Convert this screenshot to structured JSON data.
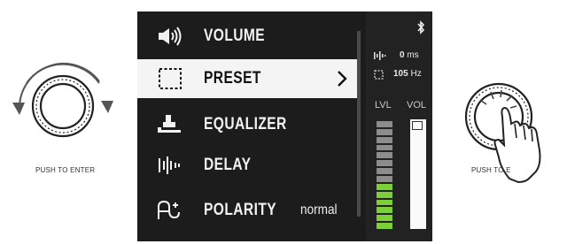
{
  "left_knob": {
    "caption": "PUSH TO ENTER"
  },
  "right_knob": {
    "caption": "PUSH TO E"
  },
  "menu": {
    "items": [
      {
        "label": "VOLUME",
        "icon": "speaker-icon",
        "selected": false,
        "value": ""
      },
      {
        "label": "PRESET",
        "icon": "dashed-square-icon",
        "selected": true,
        "value": "",
        "chevron": ">"
      },
      {
        "label": "EQUALIZER",
        "icon": "equalizer-icon",
        "selected": false,
        "value": ""
      },
      {
        "label": "DELAY",
        "icon": "delay-icon",
        "selected": false,
        "value": ""
      },
      {
        "label": "POLARITY",
        "icon": "polarity-icon",
        "selected": false,
        "value": "normal"
      }
    ]
  },
  "status": {
    "bluetooth_icon": "bluetooth-icon",
    "delay_value": "0",
    "delay_unit": "ms",
    "crossover_value": "105",
    "crossover_unit": "Hz",
    "lvl_label": "LVL",
    "vol_label": "VOL"
  },
  "meters": {
    "lvl_segments_total": 14,
    "lvl_segments_green": 6,
    "colors": {
      "green": "#7ccf3a",
      "gray": "#8c8c8c",
      "vol": "#fafafa"
    }
  }
}
